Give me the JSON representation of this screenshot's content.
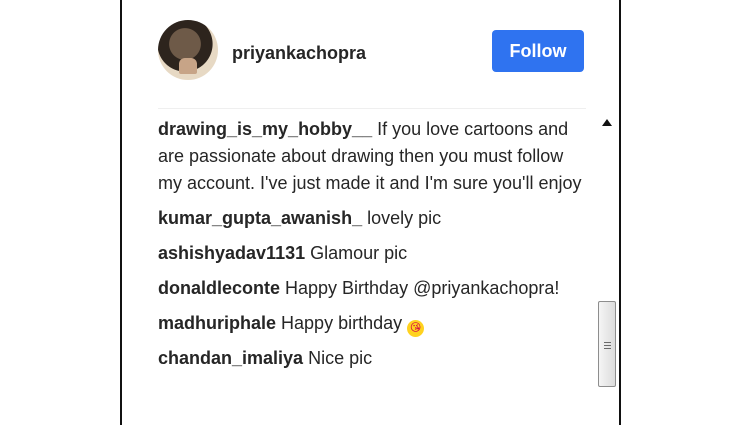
{
  "profile": {
    "username": "priyankachopra",
    "follow_label": "Follow"
  },
  "comments": [
    {
      "author": "drawing_is_my_hobby__",
      "text": "If you love cartoons and are passionate about drawing then you must follow my account. I've just made it and I'm sure you'll enjoy"
    },
    {
      "author": "kumar_gupta_awanish_",
      "text": "lovely pic"
    },
    {
      "author": "ashishyadav1131",
      "text": "Glamour pic"
    },
    {
      "author": "donaldleconte",
      "text": "Happy Birthday @priyankachopra!"
    },
    {
      "author": "madhuriphale",
      "text": "Happy birthday",
      "emoji": "😘"
    },
    {
      "author": "chandan_imaliya",
      "text": "Nice pic"
    }
  ],
  "icons": {
    "avatar": "profile-photo",
    "emoji": "face-blowing-kiss",
    "scroll_up": "triangle-up",
    "scroll_thumb": "grip-lines"
  },
  "colors": {
    "follow_button": "#2f73f0",
    "text": "#262626",
    "panel_border": "#111111"
  }
}
